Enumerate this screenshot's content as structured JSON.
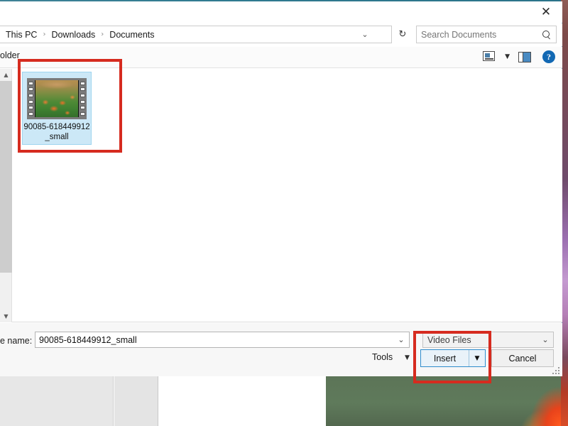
{
  "window": {
    "close_label": "✕"
  },
  "address_bar": {
    "breadcrumbs": [
      {
        "label": "This PC"
      },
      {
        "label": "Downloads"
      },
      {
        "label": "Documents"
      }
    ],
    "separator": "›",
    "dropdown_caret": "⌄",
    "refresh_glyph": "↻",
    "search_placeholder": "Search Documents",
    "search_value": ""
  },
  "toolbar": {
    "new_folder_label": "older",
    "new_folder_full_label": "New folder",
    "view_caret": "▼",
    "help_label": "?",
    "icons": {
      "view_mode": "view-mode-icon",
      "preview_pane": "preview-pane-icon",
      "help": "help-icon"
    }
  },
  "file_list": {
    "scroll_up_glyph": "▲",
    "scroll_down_glyph": "▼",
    "items": [
      {
        "name": "90085-618449912_small",
        "type": "video",
        "selected": true
      }
    ]
  },
  "bottom_bar": {
    "filename_label": "e name:",
    "filename_label_full": "File name:",
    "filename_value": "90085-618449912_small",
    "filename_caret": "⌄",
    "filetype_value": "Video Files",
    "filetype_caret": "⌄",
    "tools_label": "Tools",
    "tools_caret": "▼",
    "insert_label": "Insert",
    "insert_caret": "▼",
    "cancel_label": "Cancel"
  },
  "annotations": {
    "color": "#d62b1f",
    "regions": [
      {
        "name": "selected-file-tile"
      },
      {
        "name": "insert-button"
      }
    ]
  },
  "colors": {
    "accent_blue": "#2f8ccc",
    "selection_blue": "#cce8f7",
    "help_blue": "#1268b3",
    "annotation_red": "#d62b1f",
    "dialog_bg": "#ffffff",
    "bottom_bar_bg": "#f7f7f7"
  }
}
